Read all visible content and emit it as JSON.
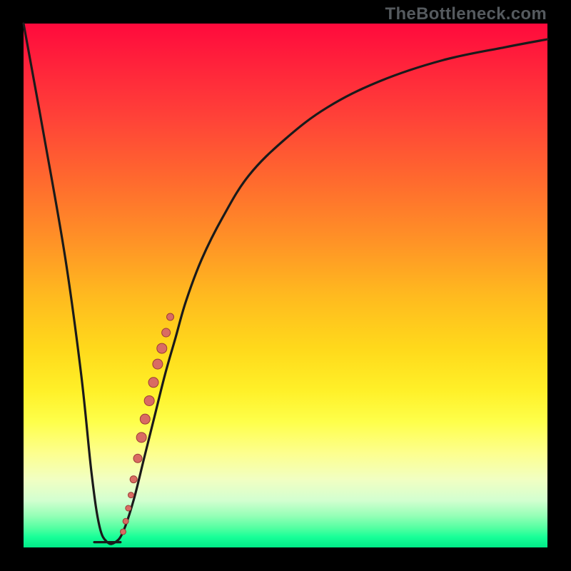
{
  "attribution": "TheBottleneck.com",
  "colors": {
    "frame": "#000000",
    "curve": "#1a1a1a",
    "dot_fill": "#d96b63",
    "dot_stroke": "#9c3c36",
    "gradient_top": "#ff0a3c",
    "gradient_bottom": "#00ea87"
  },
  "chart_data": {
    "type": "line",
    "title": "",
    "xlabel": "",
    "ylabel": "",
    "xlim": [
      0,
      100
    ],
    "ylim": [
      0,
      100
    ],
    "series": [
      {
        "name": "bottleneck-curve",
        "x": [
          0,
          4,
          8,
          11,
          13,
          14.5,
          16,
          17.5,
          19,
          21,
          23,
          25,
          27,
          29,
          31,
          34,
          38,
          43,
          50,
          58,
          68,
          80,
          92,
          100
        ],
        "y": [
          100,
          78,
          55,
          33,
          14,
          4,
          1,
          1,
          3,
          9,
          17,
          25,
          33,
          40,
          47,
          55,
          63,
          71,
          78,
          84,
          89,
          93,
          95.5,
          97
        ]
      }
    ],
    "scatter": {
      "name": "highlighted-points",
      "points": [
        {
          "x": 19.0,
          "y": 3.0,
          "r": 4
        },
        {
          "x": 19.5,
          "y": 5.0,
          "r": 4
        },
        {
          "x": 20.0,
          "y": 7.5,
          "r": 4
        },
        {
          "x": 20.5,
          "y": 10.0,
          "r": 4
        },
        {
          "x": 21.0,
          "y": 13.0,
          "r": 5
        },
        {
          "x": 21.8,
          "y": 17.0,
          "r": 6
        },
        {
          "x": 22.5,
          "y": 21.0,
          "r": 7
        },
        {
          "x": 23.2,
          "y": 24.5,
          "r": 7
        },
        {
          "x": 24.0,
          "y": 28.0,
          "r": 7
        },
        {
          "x": 24.8,
          "y": 31.5,
          "r": 7
        },
        {
          "x": 25.6,
          "y": 35.0,
          "r": 7
        },
        {
          "x": 26.4,
          "y": 38.0,
          "r": 7
        },
        {
          "x": 27.2,
          "y": 41.0,
          "r": 6
        },
        {
          "x": 28.0,
          "y": 44.0,
          "r": 5
        }
      ]
    },
    "floor_segment": {
      "x": [
        13.5,
        18.5
      ],
      "y": [
        1,
        1
      ]
    }
  }
}
